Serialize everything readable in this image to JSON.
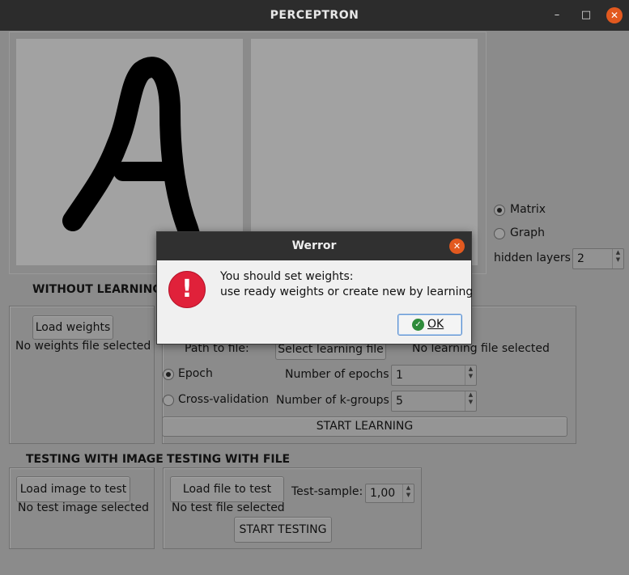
{
  "window": {
    "title": "PERCEPTRON",
    "minimize_glyph": "–",
    "maximize_glyph": "□",
    "close_glyph": "✕"
  },
  "right_panel": {
    "radio_matrix": "Matrix",
    "radio_graph": "Graph",
    "hidden_layers_label": "hidden layers",
    "hidden_layers_value": "2",
    "selected": "Matrix"
  },
  "without_learning": {
    "heading": "WITHOUT LEARNING",
    "load_weights_button": "Load weights",
    "status": "No weights file selected"
  },
  "learning": {
    "path_label": "Path to file:",
    "select_button": "Select learning file",
    "status": "No learning file selected",
    "radio_epoch": "Epoch",
    "radio_cross": "Cross-validation",
    "epochs_label": "Number of epochs",
    "epochs_value": "1",
    "kgroups_label": "Number of k-groups",
    "kgroups_value": "5",
    "start_button": "START LEARNING",
    "selected": "Epoch"
  },
  "testing_image": {
    "heading": "TESTING WITH IMAGE",
    "load_button": "Load image to test",
    "status": "No test image selected"
  },
  "testing_file": {
    "heading": "TESTING WITH FILE",
    "load_button": "Load file to test",
    "status": "No test file selected",
    "sample_label": "Test-sample:",
    "sample_value": "1,00",
    "start_button": "START TESTING"
  },
  "dialog": {
    "title": "Werror",
    "close_glyph": "✕",
    "icon_glyph": "!",
    "message_line1": "You should set weights:",
    "message_line2": "use ready weights or create new by learning",
    "ok_button": "OK",
    "ok_icon_glyph": "✓"
  },
  "colors": {
    "error_red": "#e0213a",
    "close_orange": "#e2591f",
    "ok_green": "#2e8b3a"
  }
}
